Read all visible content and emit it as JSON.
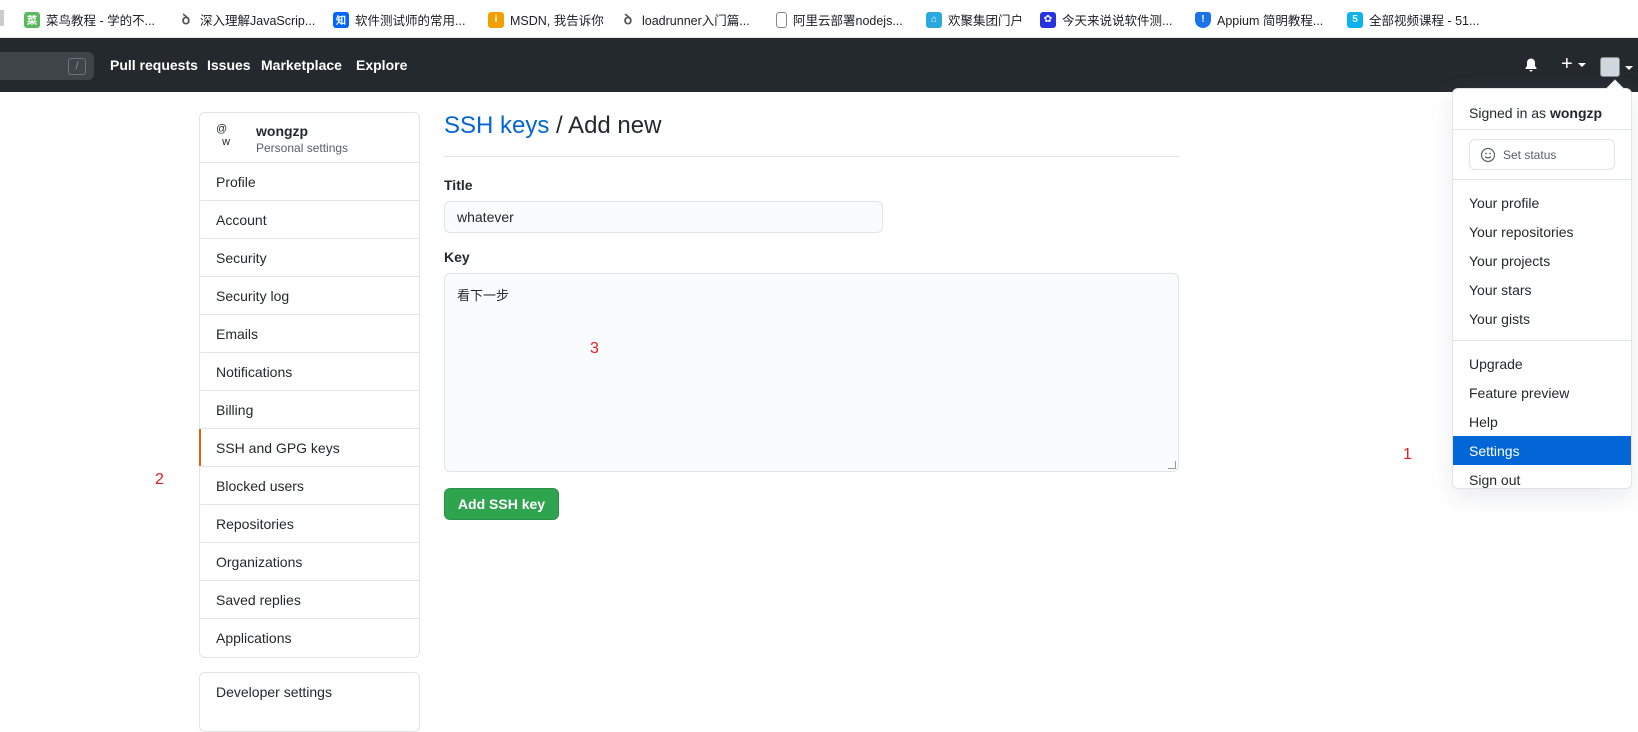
{
  "bookmarks": [
    {
      "label": "菜鸟教程 - 学的不...",
      "icon": "runoob-icon",
      "color": "#5cb85c"
    },
    {
      "label": "深入理解JavaScrip...",
      "icon": "bookmark-glyph-icon",
      "color": "#555555"
    },
    {
      "label": "软件测试师的常用...",
      "icon": "zhihu-icon",
      "color": "#0066ff"
    },
    {
      "label": "MSDN, 我告诉你",
      "icon": "msdn-icon",
      "color": "#f0a000"
    },
    {
      "label": "loadrunner入门篇...",
      "icon": "bookmark-glyph-icon",
      "color": "#555555"
    },
    {
      "label": "阿里云部署nodejs...",
      "icon": "document-icon",
      "color": "#888888"
    },
    {
      "label": "欢聚集团门户",
      "icon": "joyy-icon",
      "color": "#2aa8e0"
    },
    {
      "label": "今天来说说软件测...",
      "icon": "baidu-icon",
      "color": "#2932e1"
    },
    {
      "label": "Appium 简明教程...",
      "icon": "shield-icon",
      "color": "#1a73e8"
    },
    {
      "label": "全部视频课程 - 51...",
      "icon": "51-icon",
      "color": "#0bb4f0"
    }
  ],
  "header": {
    "search_slash": "/",
    "nav": [
      "Pull requests",
      "Issues",
      "Marketplace",
      "Explore"
    ],
    "plus": "+"
  },
  "sidebar": {
    "username": "wongzp",
    "subtitle": "Personal settings",
    "avatar_alt": "@\nw",
    "items": [
      "Profile",
      "Account",
      "Security",
      "Security log",
      "Emails",
      "Notifications",
      "Billing",
      "SSH and GPG keys",
      "Blocked users",
      "Repositories",
      "Organizations",
      "Saved replies",
      "Applications"
    ],
    "selected": "SSH and GPG keys",
    "developer": "Developer settings"
  },
  "main": {
    "heading_link": "SSH keys",
    "heading_rest": " / Add new",
    "title_label": "Title",
    "title_value": "whatever",
    "key_label": "Key",
    "key_value": "看下一步",
    "submit": "Add SSH key"
  },
  "dropdown": {
    "signed_in_prefix": "Signed in as ",
    "signed_in_user": "wongzp",
    "set_status": "Set status",
    "group1": [
      "Your profile",
      "Your repositories",
      "Your projects",
      "Your stars",
      "Your gists"
    ],
    "group2": [
      "Upgrade",
      "Feature preview",
      "Help",
      "Settings",
      "Sign out"
    ],
    "active": "Settings"
  },
  "annotations": {
    "a1": "1",
    "a2": "2",
    "a3": "3"
  },
  "colors": {
    "header_bg": "#24292e",
    "accent": "#0366d6",
    "green": "#2ea44f",
    "selected_bar": "#e36209",
    "annotation": "#e02020"
  }
}
